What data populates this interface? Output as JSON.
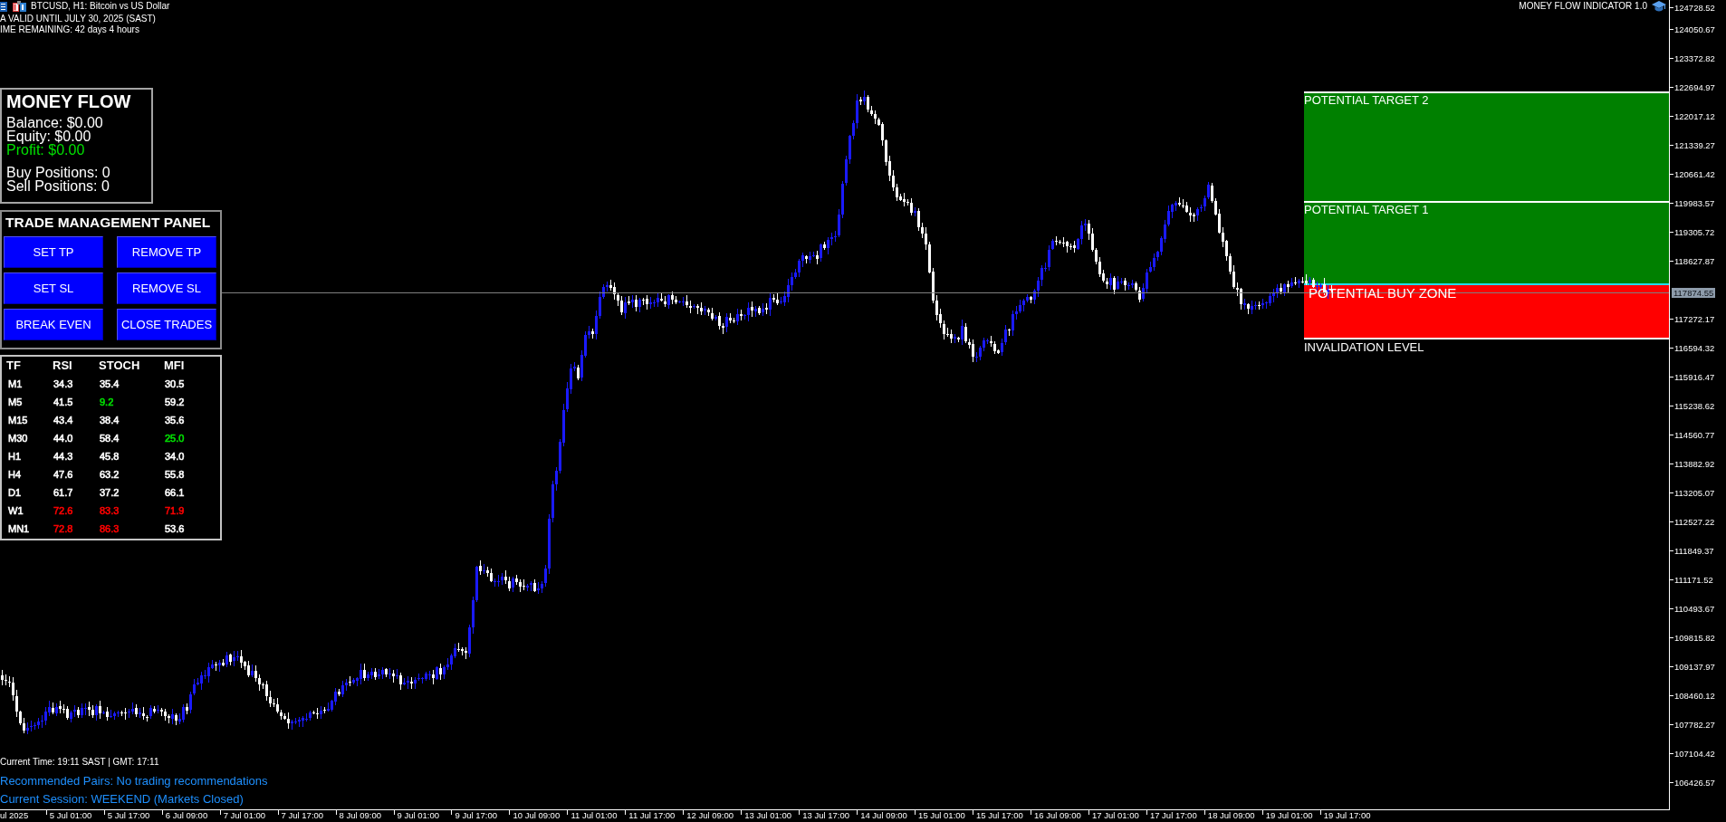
{
  "chart_header": {
    "title": "BTCUSD, H1: Bitcoin vs US Dollar",
    "notices": [
      "A VALID UNTIL JULY 30, 2025 (SAST)",
      "IME REMAINING: 42 days 4 hours"
    ]
  },
  "indicator_name": "MONEY FLOW INDICATOR 1.0",
  "account_panel": {
    "title": "MONEY FLOW",
    "lines": [
      {
        "text": "Balance: $0.00",
        "color": "#ffffff"
      },
      {
        "text": "Equity: $0.00",
        "color": "#ffffff"
      },
      {
        "text": "Profit: $0.00",
        "color": "#00e000"
      }
    ],
    "positions": [
      "Buy Positions: 0",
      "Sell Positions: 0"
    ]
  },
  "trade_panel": {
    "title": "TRADE MANAGEMENT PANEL",
    "buttons": [
      "SET TP",
      "REMOVE TP",
      "SET SL",
      "REMOVE SL",
      "BREAK EVEN",
      "CLOSE TRADES"
    ]
  },
  "indicator_table": {
    "columns": [
      "TF",
      "RSI",
      "STOCH",
      "MFI"
    ],
    "rows": [
      {
        "tf": "M1",
        "values": [
          {
            "text": "34.3",
            "color": "#ffffff"
          },
          {
            "text": "35.4",
            "color": "#ffffff"
          },
          {
            "text": "30.5",
            "color": "#ffffff"
          }
        ]
      },
      {
        "tf": "M5",
        "values": [
          {
            "text": "41.5",
            "color": "#ffffff"
          },
          {
            "text": "9.2",
            "color": "#00e000"
          },
          {
            "text": "59.2",
            "color": "#ffffff"
          }
        ]
      },
      {
        "tf": "M15",
        "values": [
          {
            "text": "43.4",
            "color": "#ffffff"
          },
          {
            "text": "38.4",
            "color": "#ffffff"
          },
          {
            "text": "35.6",
            "color": "#ffffff"
          }
        ]
      },
      {
        "tf": "M30",
        "values": [
          {
            "text": "44.0",
            "color": "#ffffff"
          },
          {
            "text": "58.4",
            "color": "#ffffff"
          },
          {
            "text": "25.0",
            "color": "#00e000"
          }
        ]
      },
      {
        "tf": "H1",
        "values": [
          {
            "text": "44.3",
            "color": "#ffffff"
          },
          {
            "text": "45.8",
            "color": "#ffffff"
          },
          {
            "text": "34.0",
            "color": "#ffffff"
          }
        ]
      },
      {
        "tf": "H4",
        "values": [
          {
            "text": "47.6",
            "color": "#ffffff"
          },
          {
            "text": "63.2",
            "color": "#ffffff"
          },
          {
            "text": "55.8",
            "color": "#ffffff"
          }
        ]
      },
      {
        "tf": "D1",
        "values": [
          {
            "text": "61.7",
            "color": "#ffffff"
          },
          {
            "text": "37.2",
            "color": "#ffffff"
          },
          {
            "text": "66.1",
            "color": "#ffffff"
          }
        ]
      },
      {
        "tf": "W1",
        "values": [
          {
            "text": "72.6",
            "color": "#ff0000"
          },
          {
            "text": "83.3",
            "color": "#ff0000"
          },
          {
            "text": "71.9",
            "color": "#ff0000"
          }
        ]
      },
      {
        "tf": "MN1",
        "values": [
          {
            "text": "72.8",
            "color": "#ff0000"
          },
          {
            "text": "86.3",
            "color": "#ff0000"
          },
          {
            "text": "53.6",
            "color": "#ffffff"
          }
        ]
      }
    ]
  },
  "zones": [
    {
      "kind": "target",
      "label": "POTENTIAL TARGET 2",
      "color": "#008000"
    },
    {
      "kind": "target",
      "label": "POTENTIAL TARGET 1",
      "color": "#008000"
    },
    {
      "kind": "entry",
      "label": "POTENTIAL BUY ZONE",
      "color": "#ff0000"
    },
    {
      "kind": "stop",
      "label": "INVALIDATION LEVEL"
    }
  ],
  "status_lines": [
    {
      "text": "Current Time: 19:11 SAST | GMT: 17:11",
      "color": "#ffffff"
    },
    {
      "text": "Recommended Pairs: No trading recommendations",
      "color": "#1e90ff"
    },
    {
      "text": "Current Session: WEEKEND (Markets Closed)",
      "color": "#1e90ff"
    }
  ],
  "price_axis": {
    "labels": [
      {
        "kind": "tick",
        "text": "124728.52"
      },
      {
        "kind": "tick",
        "text": "124050.67"
      },
      {
        "kind": "tick",
        "text": "123372.82"
      },
      {
        "kind": "tick",
        "text": "122694.97"
      },
      {
        "kind": "tick",
        "text": "122017.12"
      },
      {
        "kind": "tick",
        "text": "121339.27"
      },
      {
        "kind": "tick",
        "text": "120661.42"
      },
      {
        "kind": "tick",
        "text": "119983.57"
      },
      {
        "kind": "tick",
        "text": "119305.72"
      },
      {
        "kind": "tick",
        "text": "118627.87"
      },
      {
        "kind": "current",
        "text": "117874.55"
      },
      {
        "kind": "tick",
        "text": "117272.17"
      },
      {
        "kind": "tick",
        "text": "116594.32"
      },
      {
        "kind": "tick",
        "text": "115916.47"
      },
      {
        "kind": "tick",
        "text": "115238.62"
      },
      {
        "kind": "tick",
        "text": "114560.77"
      },
      {
        "kind": "tick",
        "text": "113882.92"
      },
      {
        "kind": "tick",
        "text": "113205.07"
      },
      {
        "kind": "tick",
        "text": "112527.22"
      },
      {
        "kind": "tick",
        "text": "111849.37"
      },
      {
        "kind": "tick",
        "text": "111171.52"
      },
      {
        "kind": "tick",
        "text": "110493.67"
      },
      {
        "kind": "tick",
        "text": "109815.82"
      },
      {
        "kind": "tick",
        "text": "109137.97"
      },
      {
        "kind": "tick",
        "text": "108460.12"
      },
      {
        "kind": "tick",
        "text": "107782.27"
      },
      {
        "kind": "tick",
        "text": "107104.42"
      },
      {
        "kind": "tick",
        "text": "106426.57"
      }
    ]
  },
  "time_axis": {
    "labels": [
      "ul 2025",
      "5 Jul 01:00",
      "5 Jul 17:00",
      "6 Jul 09:00",
      "7 Jul 01:00",
      "7 Jul 17:00",
      "8 Jul 09:00",
      "9 Jul 01:00",
      "9 Jul 17:00",
      "10 Jul 09:00",
      "11 Jul 01:00",
      "11 Jul 17:00",
      "12 Jul 09:00",
      "13 Jul 01:00",
      "13 Jul 17:00",
      "14 Jul 09:00",
      "15 Jul 01:00",
      "15 Jul 17:00",
      "16 Jul 09:00",
      "17 Jul 01:00",
      "17 Jul 17:00",
      "18 Jul 09:00",
      "19 Jul 01:00",
      "19 Jul 17:00"
    ]
  }
}
